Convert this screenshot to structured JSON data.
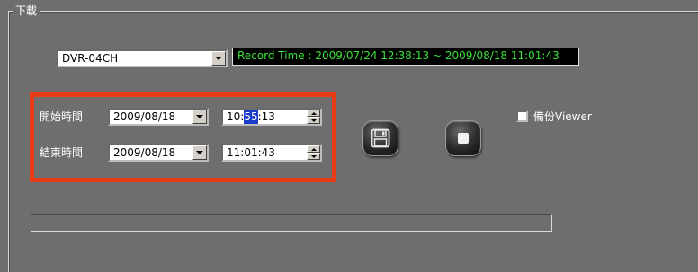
{
  "group": {
    "title": "下載"
  },
  "device": {
    "selected": "DVR-04CH"
  },
  "record_time": "Record Time : 2009/07/24 12:38:13 ~ 2009/08/18 11:01:43",
  "start": {
    "label": "開始時間",
    "date": "2009/08/18",
    "hour": "10",
    "minute": "55",
    "second": "13",
    "sep1": " : ",
    "sep2": " : "
  },
  "end": {
    "label": "結束時間",
    "date": "2009/08/18",
    "hour": "11",
    "minute": "01",
    "second": "43",
    "sep1": " : ",
    "sep2": " : "
  },
  "buttons": {
    "save_icon": "floppy-disk-icon",
    "stop_icon": "stop-square-icon"
  },
  "backup_viewer": {
    "label": "備份Viewer",
    "checked": false
  },
  "progress": {
    "value": 0
  },
  "colors": {
    "background": "#6e6e6e",
    "record_time_text": "#3be03b",
    "highlight_box": "#e83b16",
    "selection": "#1a3cc8"
  }
}
